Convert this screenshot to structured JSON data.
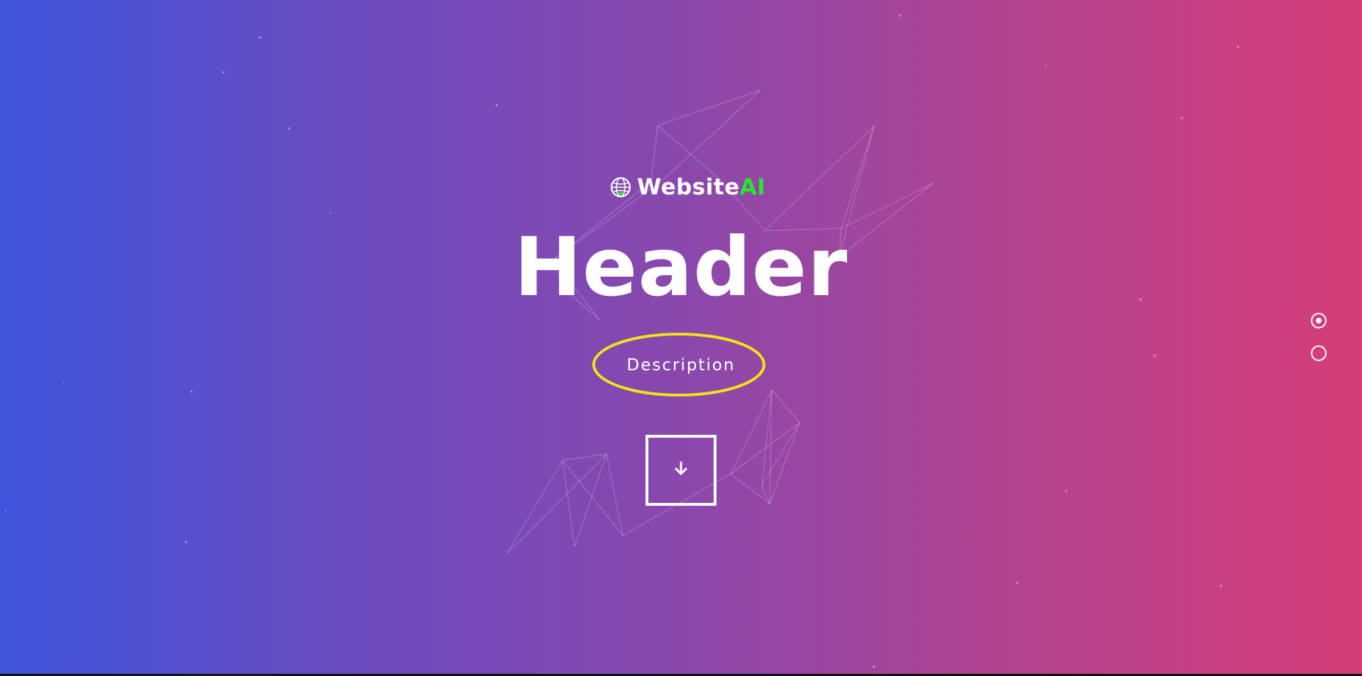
{
  "logo": {
    "text_main": "Website",
    "text_accent": "AI",
    "icon": "globe-icon",
    "accent_color": "#2ee32e"
  },
  "hero": {
    "title": "Header",
    "description": "Description",
    "scroll_icon": "arrow-down-icon",
    "background_gradient": [
      "#3f55dd",
      "#d63d79"
    ],
    "highlight_color": "#f2e21b"
  },
  "section_nav": {
    "dots": [
      {
        "icon": "section-dot-icon",
        "active": true
      },
      {
        "icon": "section-dot-icon",
        "active": false
      }
    ]
  }
}
